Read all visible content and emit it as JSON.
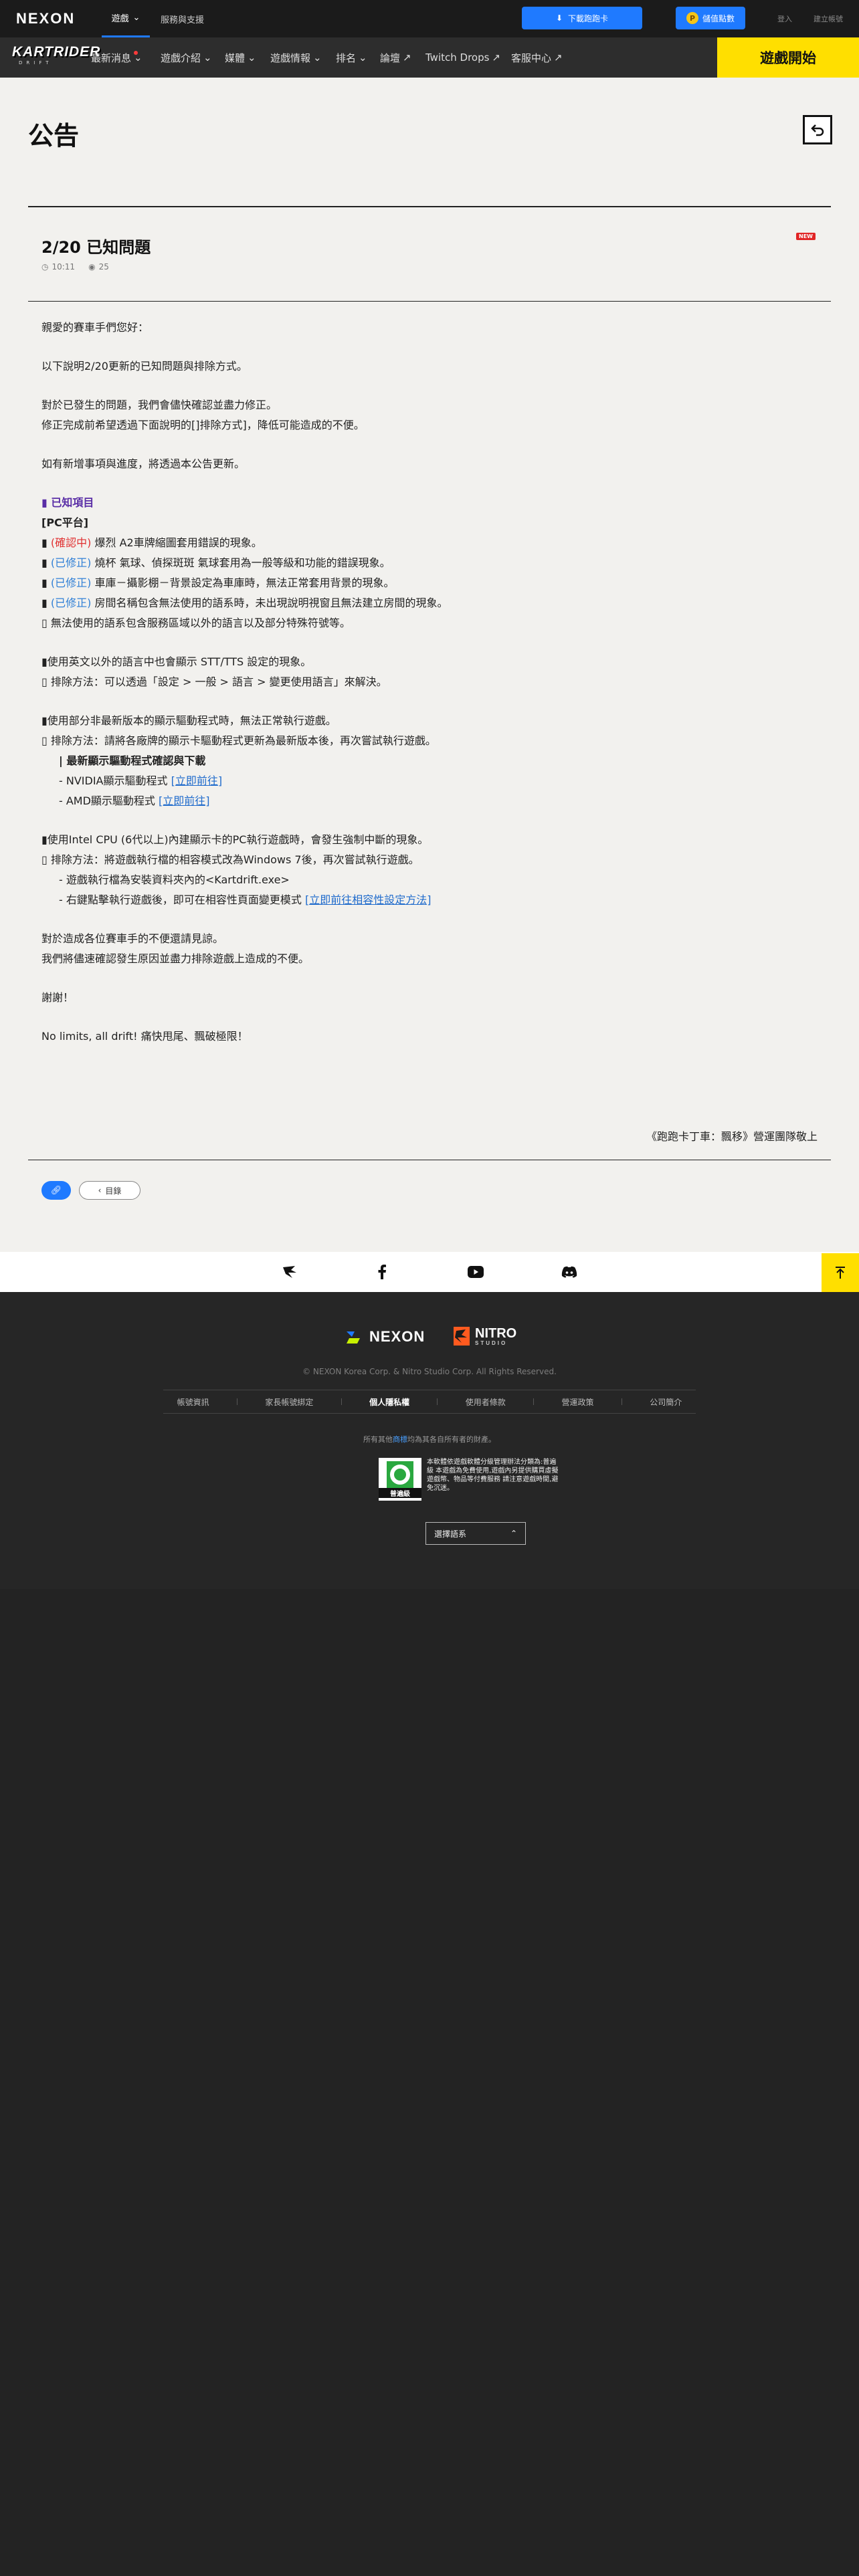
{
  "topbar": {
    "logo": "NEXON",
    "nav_game": "遊戲",
    "nav_support": "服務與支援",
    "download": "下載跑跑卡",
    "points": "儲值點數",
    "login": "登入",
    "signup": "建立帳號"
  },
  "gamenav": {
    "logo_main": "KARTRIDER",
    "logo_sub": "DRIFT",
    "items": [
      "最新消息",
      "遊戲介紹",
      "媒體",
      "遊戲情報",
      "排名",
      "論壇",
      "Twitch Drops",
      "客服中心"
    ],
    "start": "遊戲開始"
  },
  "page": {
    "title": "公告",
    "badge": "NEW",
    "post_title": "2/20 已知問題",
    "time": "10:11",
    "views": "25"
  },
  "content": {
    "l1": "親愛的賽車手們您好：",
    "l2": "以下說明2/20更新的已知問題與排除方式。",
    "l3": "對於已發生的問題，我們會儘快確認並盡力修正。",
    "l4": "修正完成前希望透過下面說明的[]排除方式]，降低可能造成的不便。",
    "l5": "如有新增事項與進度，將透過本公告更新。",
    "known_title": "▮ 已知項目",
    "pc_title": "[PC平台]",
    "i1_tag": "(確認中)",
    "i1": " 爆烈 A2車牌縮圖套用錯誤的現象。",
    "i2_tag": "(已修正)",
    "i2": " 燒杯 氣球、偵探斑斑 氣球套用為一般等級和功能的錯誤現象。",
    "i3_tag": "(已修正)",
    "i3": " 車庫－攝影棚－背景設定為車庫時，無法正常套用背景的現象。",
    "i4_tag": "(已修正)",
    "i4": " 房間名稱包含無法使用的語系時，未出現說明視窗且無法建立房間的現象。",
    "i5": "▯ 無法使用的語系包含服務區域以外的語言以及部分特殊符號等。",
    "s1": "▮使用英文以外的語言中也會顯示 STT/TTS 設定的現象。",
    "s1_fix": "▯ 排除方法：可以透過「設定 > 一般 > 語言 > 變更使用語言」來解決。",
    "s2": "▮使用部分非最新版本的顯示驅動程式時，無法正常執行遊戲。",
    "s2_fix": "▯ 排除方法：請將各廠牌的顯示卡驅動程式更新為最新版本後，再次嘗試執行遊戲。",
    "s2_sub": "| 最新顯示驅動程式確認與下載",
    "nvidia": "- NVIDIA顯示驅動程式 ",
    "amd": "- AMD顯示驅動程式 ",
    "goto": "[立即前往]",
    "s3": "▮使用Intel CPU (6代以上)內建顯示卡的PC執行遊戲時，會發生強制中斷的現象。",
    "s3_fix": "▯ 排除方法：將遊戲執行檔的相容模式改為Windows 7後，再次嘗試執行遊戲。",
    "s3_a": "- 遊戲執行檔為安裝資料夾內的<Kartdrift.exe>",
    "s3_b": "- 右鍵點擊執行遊戲後，即可在相容性頁面變更模式 ",
    "s3_link": "[立即前往相容性設定方法]",
    "e1": "對於造成各位賽車手的不便還請見諒。",
    "e2": "我們將儘速確認發生原因並盡力排除遊戲上造成的不便。",
    "e3": "謝謝！",
    "e4": "No limits, all drift! 痛快甩尾、飄破極限！",
    "signoff": "《跑跑卡丁車：飄移》營運團隊敬上",
    "list_btn": "目錄"
  },
  "footer": {
    "nexon": "NEXON",
    "nitro_1": "NITRO",
    "nitro_2": "STUDIO",
    "copyright": "© NEXON Korea Corp. & Nitro Studio Corp. All Rights Reserved.",
    "links": [
      "帳號資訊",
      "家長帳號綁定",
      "個人隱私權",
      "使用者條款",
      "營運政策",
      "公司簡介"
    ],
    "owner_pre": "所有其他",
    "owner_link": "商標",
    "owner_post": "均為其各自所有者的財產。",
    "rating_label": "普遍級",
    "rating_text": "本軟體依遊戲軟體分級管理辦法分類為:普遍級 本遊戲為免費使用,遊戲內另提供購買虛擬遊戲幣、物品等付費服務 請注意遊戲時間,避免沉迷。",
    "language": "選擇語系"
  },
  "colors": {
    "accent": "#1f7aff",
    "start": "#ffdf00",
    "red": "#e03030",
    "blue": "#2f7fd6",
    "purple": "#5a2ea6"
  }
}
